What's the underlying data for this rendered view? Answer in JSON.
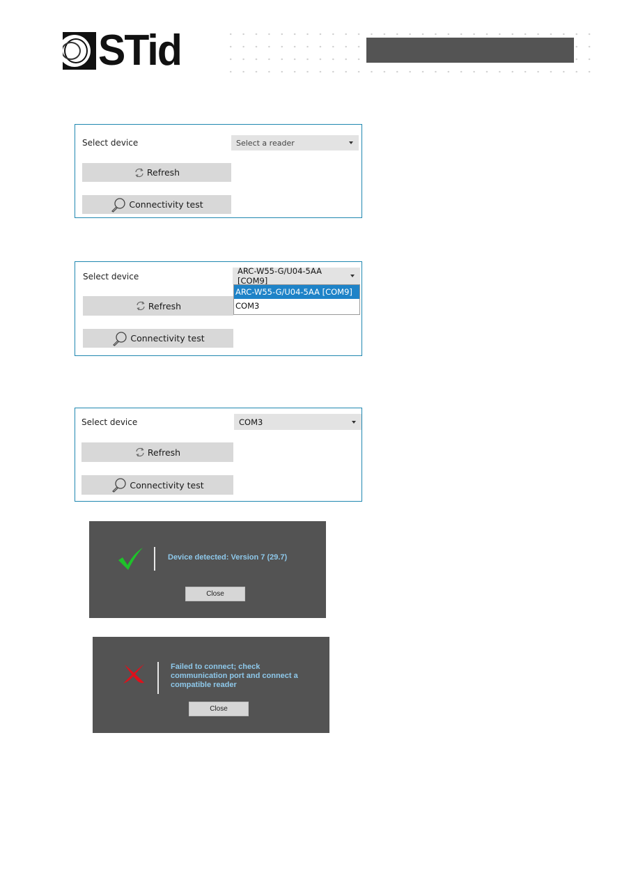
{
  "header": {
    "logo_text": "STid"
  },
  "panels": [
    {
      "select_label": "Select device",
      "combo_value": "Select a reader",
      "refresh_label": "Refresh",
      "connectivity_label": "Connectivity test"
    },
    {
      "select_label": "Select device",
      "combo_value": "ARC-W55-G/U04-5AA [COM9]",
      "dropdown_options": [
        "ARC-W55-G/U04-5AA [COM9]",
        "COM3"
      ],
      "selected_option_index": 0,
      "refresh_label": "Refresh",
      "connectivity_label": "Connectivity test"
    },
    {
      "select_label": "Select device",
      "combo_value": "COM3",
      "refresh_label": "Refresh",
      "connectivity_label": "Connectivity test"
    }
  ],
  "dialogs": {
    "success": {
      "icon": "check-icon",
      "message": "Device detected: Version 7 (29.7)",
      "close_label": "Close"
    },
    "failure": {
      "icon": "cross-icon",
      "message_lines": [
        "Failed to connect; check",
        "communication port and connect a",
        "compatible reader"
      ],
      "close_label": "Close"
    }
  },
  "colors": {
    "panel_border": "#1f87b0",
    "selection": "#1e83c8",
    "dialog_bg": "#535353",
    "dialog_text": "#8ec8ea",
    "success": "#1ec22a",
    "failure": "#e0101a",
    "header_bar": "#545454"
  }
}
